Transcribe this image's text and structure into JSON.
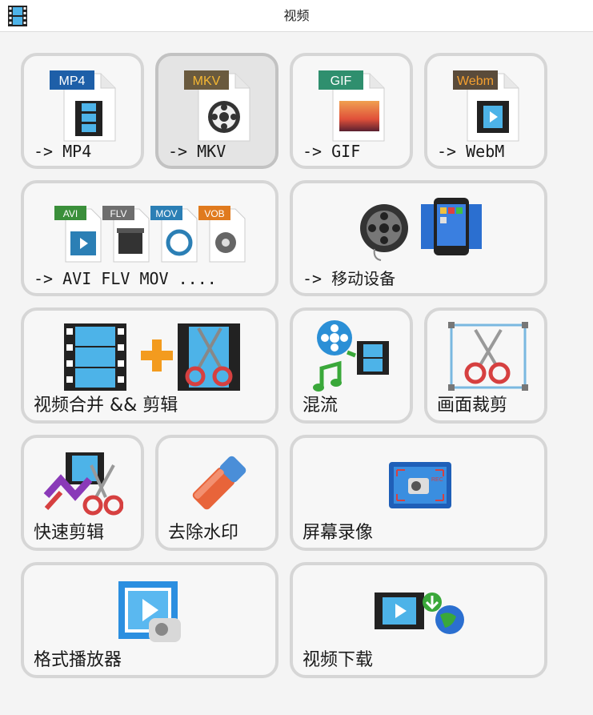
{
  "window": {
    "title": "视频"
  },
  "tiles": [
    {
      "label": "-> MP4",
      "badge": "MP4"
    },
    {
      "label": "-> MKV",
      "badge": "MKV"
    },
    {
      "label": "-> GIF",
      "badge": "GIF"
    },
    {
      "label": "-> WebM",
      "badge": "Webm"
    },
    {
      "label": "-> AVI FLV MOV ....",
      "badges": [
        "AVI",
        "FLV",
        "MOV",
        "VOB"
      ]
    },
    {
      "label": "-> 移动设备"
    },
    {
      "label": "视频合并 && 剪辑"
    },
    {
      "label": "混流"
    },
    {
      "label": "画面裁剪"
    },
    {
      "label": "快速剪辑"
    },
    {
      "label": "去除水印"
    },
    {
      "label": "屏幕录像",
      "badge": "REC"
    },
    {
      "label": "格式播放器"
    },
    {
      "label": "视频下载"
    }
  ],
  "colors": {
    "mp4": "#1e5fa8",
    "mkv": "#6a5a3e",
    "gif": "#2f8f6e",
    "webm": "#5a4b3a",
    "avi": "#3a8f3a",
    "flv": "#6e6e6e",
    "mov": "#2b7fb5",
    "vob": "#e07a1e",
    "film": "#3ea7d6",
    "scissors": "#d64040",
    "plus": "#f39b1e"
  }
}
